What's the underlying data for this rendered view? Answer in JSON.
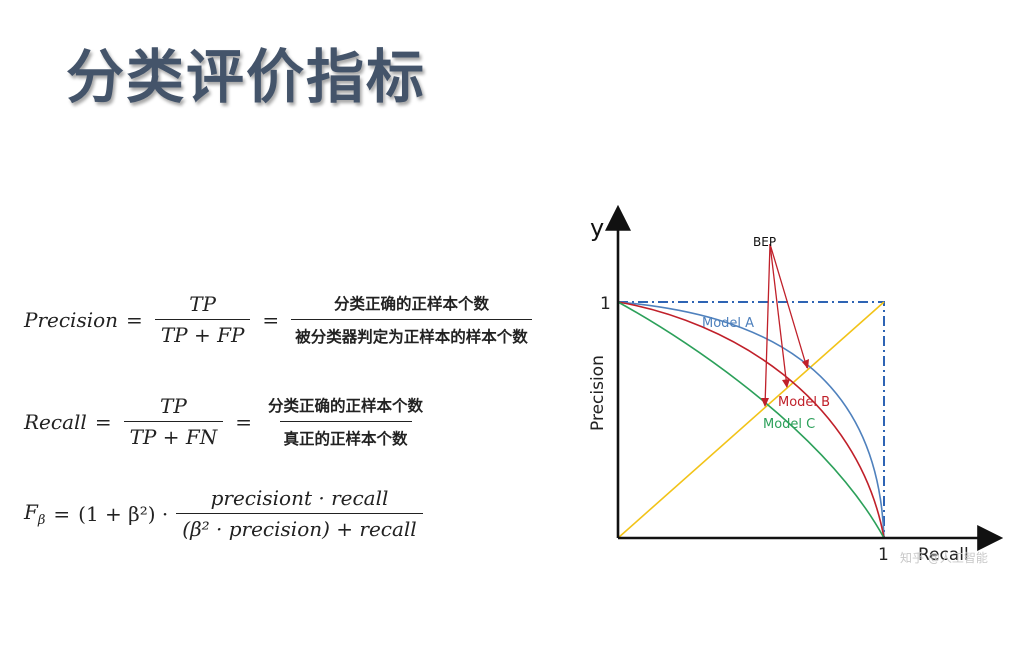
{
  "slide": {
    "title": "分类评价指标"
  },
  "formulas": {
    "precision": {
      "lhs": "Precision",
      "eq": "=",
      "num": "TP",
      "den": "TP + FP",
      "eq2": "=",
      "cn_num": "分类正确的正样本个数",
      "cn_den": "被分类器判定为正样本的样本个数"
    },
    "recall": {
      "lhs": "Recall",
      "eq": "=",
      "num": "TP",
      "den": "TP + FN",
      "eq2": "=",
      "cn_num": "分类正确的正样本个数",
      "cn_den": "真正的正样本个数"
    },
    "fbeta": {
      "lhs": "F",
      "lhs_sub": "β",
      "eq": "=",
      "coef": "(1 + β²) ·",
      "num": "precisiont · recall",
      "den": "(β² · precision) + recall"
    }
  },
  "diagram": {
    "y_axis_label": "y",
    "y_title": "Precision",
    "x_title": "Recall",
    "y_tick": "1",
    "x_tick": "1",
    "bep_label": "BEP",
    "watermark": "知乎 @人工智能",
    "models": [
      {
        "label": "Model A",
        "color": "#4f81bd"
      },
      {
        "label": "Model B",
        "color": "#c0202a"
      },
      {
        "label": "Model C",
        "color": "#2ca05a"
      }
    ],
    "diagonal_color": "#f2c318",
    "box_color": "#2e64b4",
    "arrow_color": "#c0202a"
  }
}
